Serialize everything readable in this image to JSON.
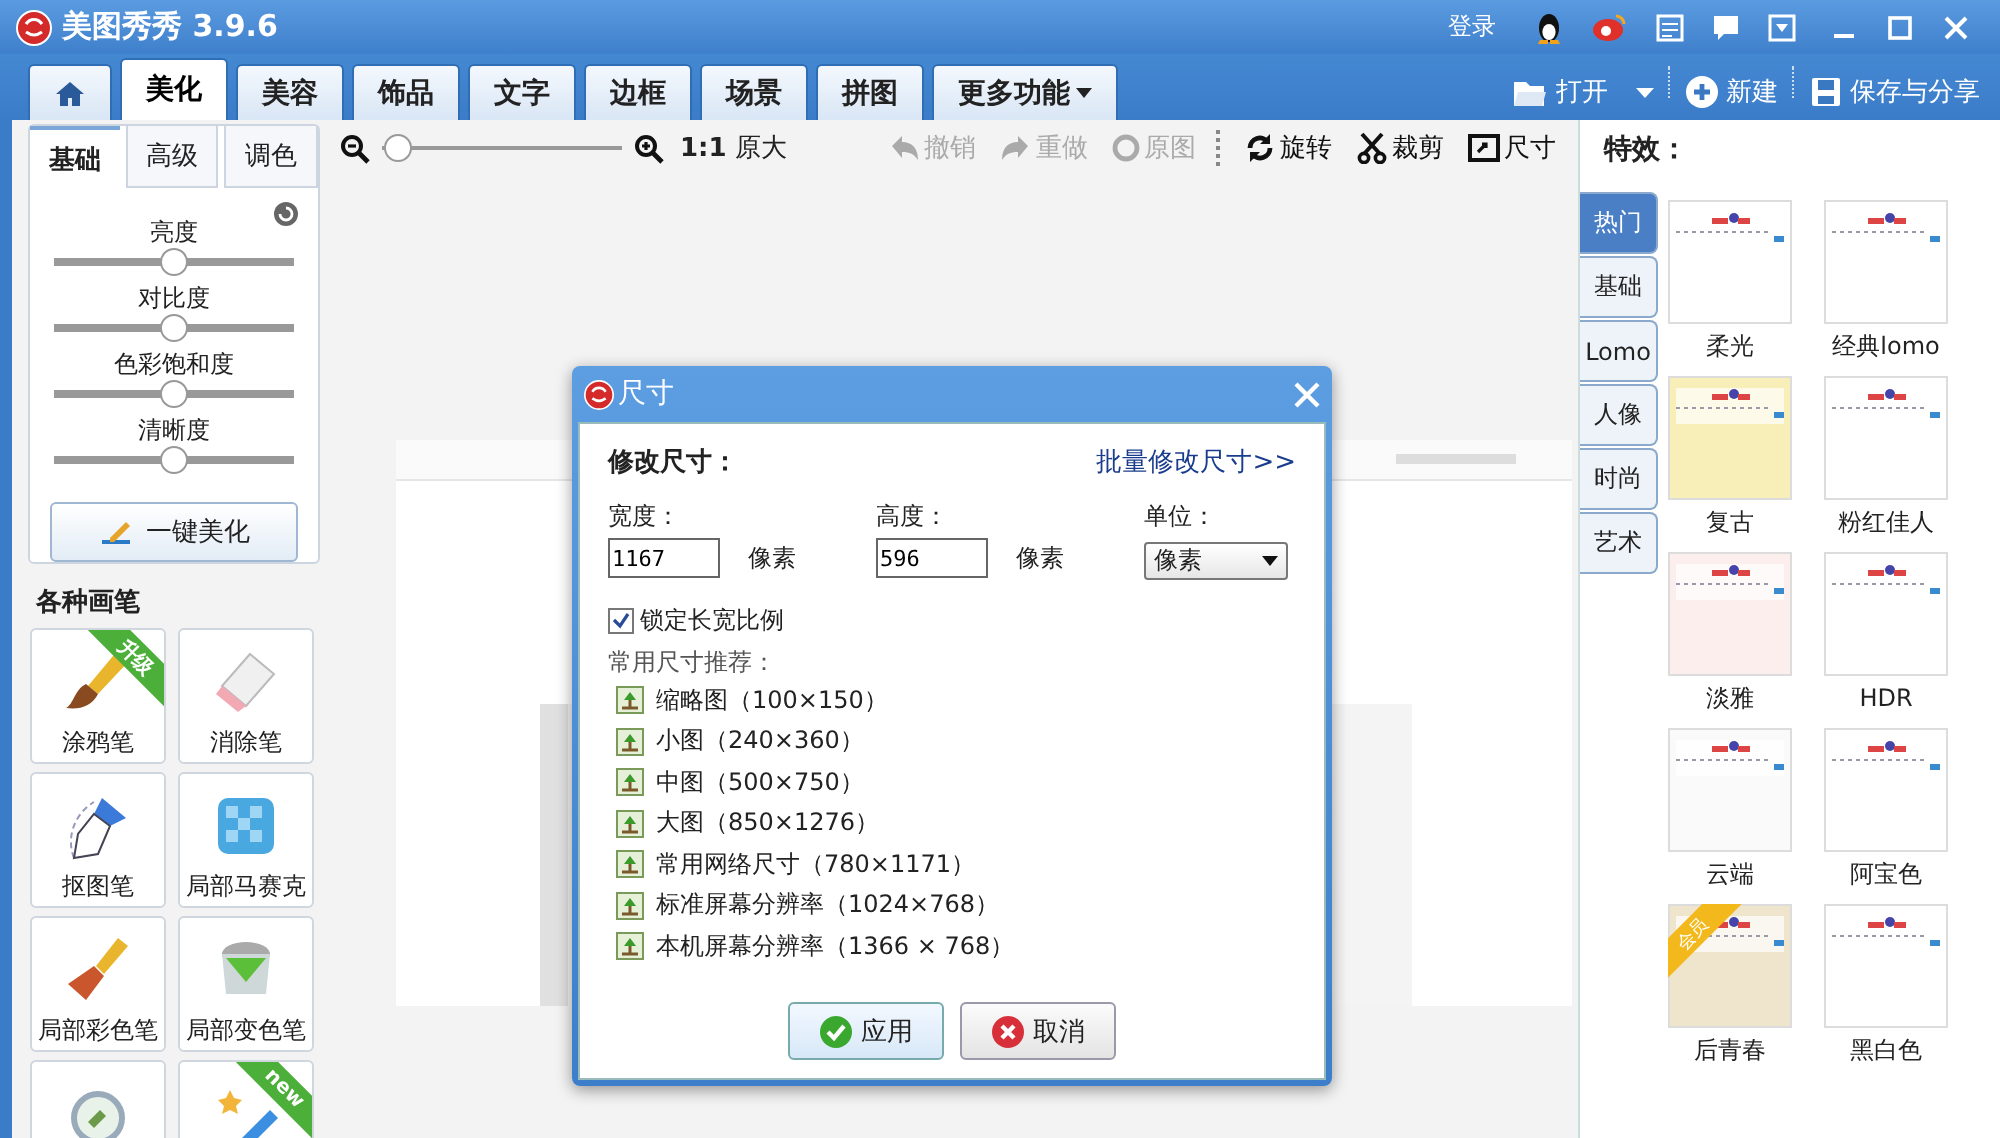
{
  "window": {
    "title": "美图秀秀 3.9.6",
    "login": "登录"
  },
  "tabs": [
    {
      "kind": "home",
      "selected": false
    },
    {
      "kind": "text",
      "label": "美化",
      "selected": true
    },
    {
      "kind": "text",
      "label": "美容",
      "selected": false
    },
    {
      "kind": "text",
      "label": "饰品",
      "selected": false
    },
    {
      "kind": "text",
      "label": "文字",
      "selected": false
    },
    {
      "kind": "text",
      "label": "边框",
      "selected": false
    },
    {
      "kind": "text",
      "label": "场景",
      "selected": false
    },
    {
      "kind": "text",
      "label": "拼图",
      "selected": false
    },
    {
      "kind": "menu",
      "label": "更多功能",
      "selected": false
    }
  ],
  "file_actions": [
    {
      "kind": "open",
      "label": "打开"
    },
    {
      "kind": "new",
      "label": "新建"
    },
    {
      "kind": "save",
      "label": "保存与分享"
    }
  ],
  "adjust_panel": {
    "tabs": [
      {
        "label": "基础",
        "selected": true
      },
      {
        "label": "高级",
        "selected": false
      },
      {
        "label": "调色",
        "selected": false
      }
    ],
    "sliders": [
      {
        "label": "亮度",
        "level": 0.5
      },
      {
        "label": "对比度",
        "level": 0.5
      },
      {
        "label": "色彩饱和度",
        "level": 0.5
      },
      {
        "label": "清晰度",
        "level": 0.5
      }
    ],
    "button": "一键美化"
  },
  "brushes": {
    "title": "各种画笔",
    "items": [
      {
        "kind": "paint",
        "label": "涂鸦笔",
        "badge": "升级"
      },
      {
        "kind": "eraser",
        "label": "消除笔"
      },
      {
        "kind": "pen",
        "label": "抠图笔"
      },
      {
        "kind": "mosaic",
        "label": "局部马赛克"
      },
      {
        "kind": "brush",
        "label": "局部彩色笔"
      },
      {
        "kind": "bucket",
        "label": "局部变色笔"
      },
      {
        "kind": "magnifier"
      },
      {
        "kind": "wand",
        "badge": "new"
      }
    ]
  },
  "toolbar": {
    "zoom": {
      "level": 0.03
    },
    "actual_size": "**1:1** 原大",
    "actions": [
      {
        "kind": "undo",
        "label": "撤销",
        "disabled": true
      },
      {
        "kind": "redo",
        "label": "重做",
        "disabled": true
      },
      {
        "kind": "original",
        "label": "原图",
        "disabled": true
      },
      {
        "kind": "rotate",
        "label": "旋转",
        "disabled": false
      },
      {
        "kind": "crop",
        "label": "裁剪",
        "disabled": false
      },
      {
        "kind": "resize",
        "label": "尺寸",
        "disabled": false
      }
    ]
  },
  "dialog": {
    "title": "尺寸",
    "heading": "修改尺寸：",
    "link": "批量修改尺寸>>",
    "width": {
      "label": "宽度：",
      "value": "1167",
      "unit": "像素"
    },
    "height": {
      "label": "高度：",
      "value": "596",
      "unit": "像素"
    },
    "unit": {
      "label": "单位：",
      "value": "像素"
    },
    "lock": {
      "label": "锁定长宽比例",
      "checked": true
    },
    "presets_title": "常用尺寸推荐：",
    "presets": [
      "缩略图（100×150）",
      "小图（240×360）",
      "中图（500×750）",
      "大图（850×1276）",
      "常用网络尺寸（780×1171）",
      "标准屏幕分辨率（1024×768）",
      "本机屏幕分辨率（1366 × 768）"
    ],
    "buttons": [
      {
        "kind": "apply",
        "label": "应用"
      },
      {
        "kind": "cancel",
        "label": "取消"
      }
    ]
  },
  "effects": {
    "title": "特效：",
    "tabs": [
      {
        "label": "热门",
        "selected": true
      },
      {
        "label": "基础",
        "selected": false
      },
      {
        "label": "Lomo",
        "selected": false
      },
      {
        "label": "人像",
        "selected": false
      },
      {
        "label": "时尚",
        "selected": false
      },
      {
        "label": "艺术",
        "selected": false
      }
    ],
    "items": [
      {
        "label": "柔光",
        "color": "#ffffff"
      },
      {
        "label": "经典lomo",
        "color": "#ffffff"
      },
      {
        "label": "复古",
        "color": "#f8eeb8"
      },
      {
        "label": "粉红佳人",
        "color": "#ffffff"
      },
      {
        "label": "淡雅",
        "color": "#fdeeee"
      },
      {
        "label": "HDR",
        "color": "#ffffff"
      },
      {
        "label": "云端",
        "color": "#fafafa"
      },
      {
        "label": "阿宝色",
        "color": "#ffffff"
      },
      {
        "label": "后青春",
        "color": "#efe4cc",
        "badge": "会员"
      },
      {
        "label": "黑白色",
        "color": "#ffffff"
      }
    ]
  }
}
